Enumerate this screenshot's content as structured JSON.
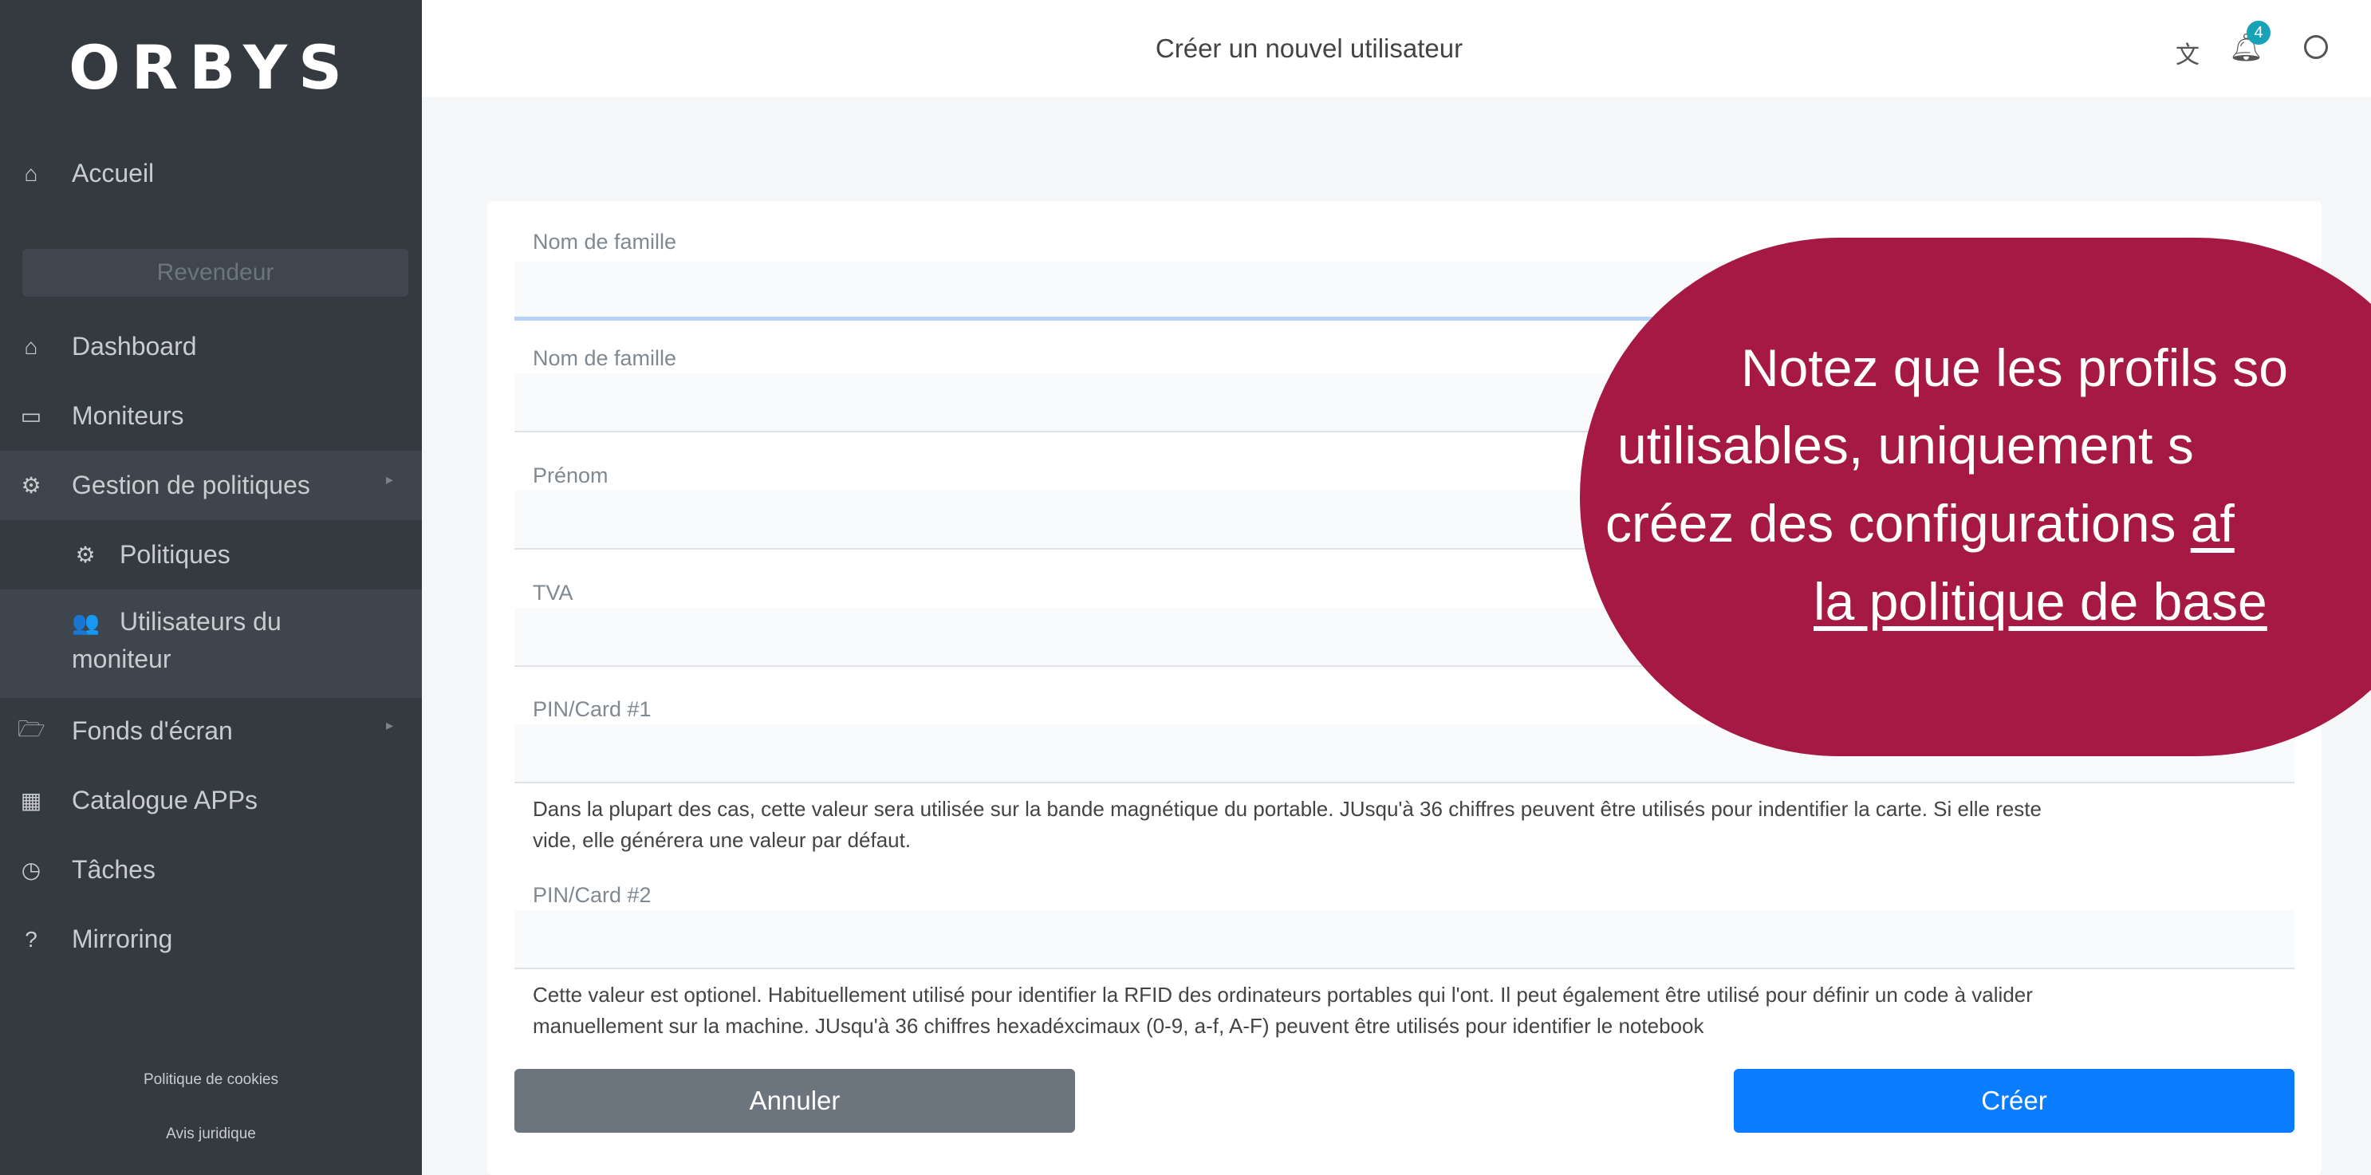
{
  "app": {
    "logo": "ORBYS"
  },
  "sidebar": {
    "home": {
      "label": "Accueil",
      "icon": "home-icon"
    },
    "section_label": "Revendeur",
    "items": [
      {
        "label": "Dashboard",
        "icon": "home-icon"
      },
      {
        "label": "Moniteurs",
        "icon": "monitor-icon"
      },
      {
        "label": "Gestion de politiques",
        "icon": "gears-icon"
      },
      {
        "label": "Politiques",
        "icon": "gears-icon"
      },
      {
        "label": "Utilisateurs du",
        "label2": "moniteur",
        "icon": "users-icon"
      },
      {
        "label": "Fonds d'écran",
        "icon": "folder-icon"
      },
      {
        "label": "Catalogue APPs",
        "icon": "grid-icon"
      },
      {
        "label": "Tâches",
        "icon": "clock-icon"
      },
      {
        "label": "Mirroring",
        "icon": "question-circle-icon"
      }
    ],
    "footer": {
      "cookies": "Politique de cookies",
      "legal": "Avis juridique"
    }
  },
  "header": {
    "title": "Créer un nouvel utilisateur",
    "notification_count": "4",
    "icons": [
      "translate-icon",
      "bell-icon",
      "user-circle-icon"
    ]
  },
  "form": {
    "fields": [
      {
        "label": "Nom de famille",
        "value": ""
      },
      {
        "label": "Nom de famille",
        "value": ""
      },
      {
        "label": "Prénom",
        "value": ""
      },
      {
        "label": "TVA",
        "value": ""
      },
      {
        "label": "PIN/Card #1",
        "value": ""
      },
      {
        "label": "PIN/Card #2",
        "value": ""
      }
    ],
    "help1_line1": "Dans la plupart des cas, cette valeur sera utilisée sur la bande magnétique du portable. JUsqu'à 36 chiffres peuvent être utilisés pour indentifier la carte. Si elle reste",
    "help1_line2": "vide, elle générera une valeur par défaut.",
    "help2_line1": "Cette valeur est optionel. Habituellement utilisé pour identifier la RFID des ordinateurs portables qui l'ont. Il peut également être utilisé pour définir un code à valider",
    "help2_line2": "manuellement sur la machine. JUsqu'à 36 chiffres hexadéxcimaux (0-9, a-f, A-F) peuvent être utilisés pour identifier le notebook",
    "cancel_label": "Annuler",
    "create_label": "Créer"
  },
  "overlay": {
    "line1": "Notez que les profils so",
    "line2": "utilisables, uniquement s",
    "line3_plain": "créez des configurations ",
    "line3_underlined": "af",
    "line4_underlined": "la politique de base",
    "color": "#a51944"
  },
  "colors": {
    "sidebar": "#343a40",
    "primary": "#0a7cff",
    "secondary": "#6c757d",
    "badge": "#17a2b8"
  }
}
